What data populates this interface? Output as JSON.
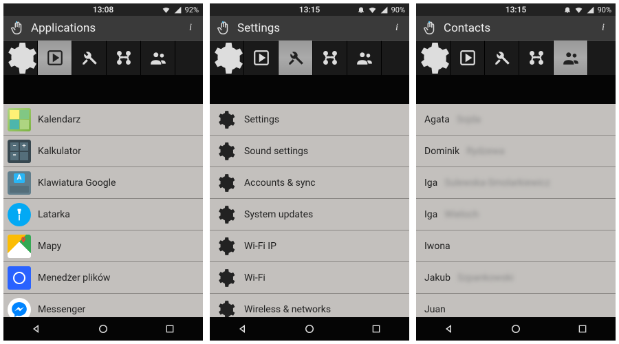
{
  "screens": [
    {
      "statusbar": {
        "time": "13:08",
        "battery": "92%",
        "icons": {
          "bell": false,
          "wifi": true,
          "signal": true
        }
      },
      "title": "Applications",
      "activeTab": 1,
      "listType": "apps",
      "items": [
        {
          "label": "Kalendarz",
          "icon": "calendar",
          "bg": "#8bc34a"
        },
        {
          "label": "Kalkulator",
          "icon": "calc",
          "bg": "#455a64"
        },
        {
          "label": "Klawiatura Google",
          "icon": "keyboard",
          "bg": "#546e7a"
        },
        {
          "label": "Latarka",
          "icon": "torch",
          "bg": "#03a9f4"
        },
        {
          "label": "Mapy",
          "icon": "maps",
          "bg": "#fff"
        },
        {
          "label": "Menedżer plików",
          "icon": "files",
          "bg": "#2962ff"
        },
        {
          "label": "Messenger",
          "icon": "messenger",
          "bg": "#fff"
        }
      ]
    },
    {
      "statusbar": {
        "time": "13:15",
        "battery": "90%",
        "icons": {
          "bell": true,
          "wifi": true,
          "signal": true
        }
      },
      "title": "Settings",
      "activeTab": 2,
      "listType": "settings",
      "items": [
        {
          "label": "Settings"
        },
        {
          "label": "Sound settings"
        },
        {
          "label": "Accounts & sync"
        },
        {
          "label": "System updates"
        },
        {
          "label": "Wi-Fi IP"
        },
        {
          "label": "Wi-Fi"
        },
        {
          "label": "Wireless & networks"
        }
      ]
    },
    {
      "statusbar": {
        "time": "13:15",
        "battery": "90%",
        "icons": {
          "bell": true,
          "wifi": true,
          "signal": true
        }
      },
      "title": "Contacts",
      "activeTab": 4,
      "listType": "contacts",
      "items": [
        {
          "label": "Agata",
          "extra": "Sojda"
        },
        {
          "label": "Dominik",
          "extra": "Rydzewa"
        },
        {
          "label": "Iga",
          "extra": "Sulewska-Smolarkiewicz"
        },
        {
          "label": "Iga",
          "extra": "Wieloch"
        },
        {
          "label": "Iwona",
          "extra": ""
        },
        {
          "label": "Jakub",
          "extra": "Szpankowski"
        },
        {
          "label": "Juan",
          "extra": ""
        }
      ]
    }
  ],
  "tabs": [
    "gear",
    "play",
    "tools",
    "connections",
    "people"
  ]
}
